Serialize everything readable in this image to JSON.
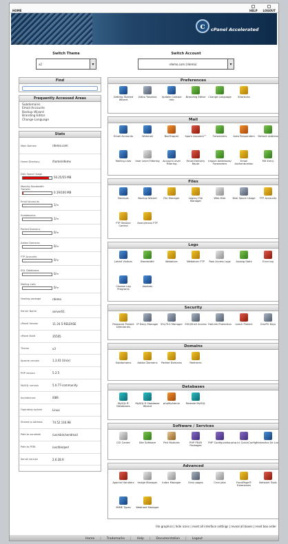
{
  "toolbar": {
    "home": "HOME",
    "help": "HELP",
    "logout": "LOGOUT"
  },
  "banner": {
    "logo_letter": "c",
    "brand": "cPanel Accelerated"
  },
  "crumb": "CPANEL 11",
  "switch_theme": {
    "label": "Switch Theme",
    "value": "x2"
  },
  "switch_account": {
    "label": "Switch Account",
    "value": "rdemo.com (rdemo)"
  },
  "find": {
    "title": "Find",
    "placeholder": ""
  },
  "faa": {
    "title": "Frequently Accessed Areas",
    "links": [
      "Subdomains",
      "Email Accounts",
      "Backup Wizard",
      "Branding Editor",
      "Change Language"
    ]
  },
  "stats": {
    "title": "Stats",
    "rows": [
      {
        "k": "Main Domain",
        "v": "rdemo.com"
      },
      {
        "k": "Home Directory",
        "v": "/home/rdemo"
      },
      {
        "k": "Disk Space Usage",
        "v": "50.25/55 MB",
        "bar": 0.91
      },
      {
        "k": "Monthly Bandwidth Transfer",
        "v": "0.19/100 MB",
        "bar": 0.002
      },
      {
        "k": "Email Accounts",
        "v": "1/∞",
        "bar": 0
      },
      {
        "k": "Subdomains",
        "v": "1/∞",
        "bar": 0
      },
      {
        "k": "Parked Domains",
        "v": "0/∞",
        "bar": 0
      },
      {
        "k": "Addon Domains",
        "v": "0/∞",
        "bar": 0
      },
      {
        "k": "FTP Accounts",
        "v": "0/∞",
        "bar": 0
      },
      {
        "k": "SQL Databases",
        "v": "0/∞",
        "bar": 0
      },
      {
        "k": "Mailing Lists",
        "v": "0/∞",
        "bar": 0
      },
      {
        "k": "Hosting package",
        "v": "rdemo"
      },
      {
        "k": "Server Name",
        "v": "server01"
      },
      {
        "k": "cPanel Version",
        "v": "11.24.5-RELEASE"
      },
      {
        "k": "cPanel Build",
        "v": "35505"
      },
      {
        "k": "Theme",
        "v": "x3"
      },
      {
        "k": "Apache version",
        "v": "1.3.41 (Unix)"
      },
      {
        "k": "PHP version",
        "v": "5.2.5"
      },
      {
        "k": "MySQL version",
        "v": "5.0.77-community"
      },
      {
        "k": "Architecture",
        "v": "i686"
      },
      {
        "k": "Operating system",
        "v": "Linux"
      },
      {
        "k": "Shared Ip Address",
        "v": "74.52.116.98"
      },
      {
        "k": "Path to sendmail",
        "v": "/usr/sbin/sendmail"
      },
      {
        "k": "Path to PERL",
        "v": "/usr/bin/perl"
      },
      {
        "k": "Kernel version",
        "v": "2.6.28.9"
      }
    ]
  },
  "sections": [
    {
      "id": "preferences",
      "title": "Preferences",
      "items": [
        {
          "label": "Getting Started Wizard",
          "icon": "wizard-icon",
          "c": "a"
        },
        {
          "label": "Video Tutorials",
          "icon": "video-icon",
          "c": "e"
        },
        {
          "label": "Update Contact Info",
          "icon": "contact-icon",
          "c": "a"
        },
        {
          "label": "Branding Editor",
          "icon": "branding-icon",
          "c": "c"
        },
        {
          "label": "Change Language",
          "icon": "language-icon",
          "c": "c"
        },
        {
          "label": "Shortcuts",
          "icon": "star-icon",
          "c": "b"
        }
      ]
    },
    {
      "id": "mail",
      "title": "Mail",
      "items": [
        {
          "label": "Email Accounts",
          "icon": "email-accounts-icon",
          "c": "a"
        },
        {
          "label": "Webmail",
          "icon": "webmail-icon",
          "c": "a"
        },
        {
          "label": "BoxTrapper",
          "icon": "boxtrapper-icon",
          "c": "f"
        },
        {
          "label": "Spam Assassin™",
          "icon": "spam-icon",
          "c": "d"
        },
        {
          "label": "Forwarders",
          "icon": "forwarders-icon",
          "c": "c"
        },
        {
          "label": "Auto Responders",
          "icon": "autoresponder-icon",
          "c": "f"
        },
        {
          "label": "Default Address",
          "icon": "default-address-icon",
          "c": "c"
        },
        {
          "label": "Mailing Lists",
          "icon": "mailing-list-icon",
          "c": "a"
        },
        {
          "label": "User Level Filtering",
          "icon": "user-filter-icon",
          "c": "i"
        },
        {
          "label": "Account Level Filtering",
          "icon": "account-filter-icon",
          "c": "a"
        },
        {
          "label": "Email Delivery Route",
          "icon": "delivery-route-icon",
          "c": "d"
        },
        {
          "label": "Import Addresses/ Forwarders",
          "icon": "import-icon",
          "c": "c"
        },
        {
          "label": "Email Authentication",
          "icon": "email-auth-icon",
          "c": "b"
        },
        {
          "label": "MX Entry",
          "icon": "mx-icon",
          "c": "c"
        }
      ]
    },
    {
      "id": "files",
      "title": "Files",
      "items": [
        {
          "label": "Backups",
          "icon": "backups-icon",
          "c": "a"
        },
        {
          "label": "Backup Wizard",
          "icon": "backup-wizard-icon",
          "c": "a"
        },
        {
          "label": "File Manager",
          "icon": "file-manager-icon",
          "c": "b"
        },
        {
          "label": "Legacy File Manager",
          "icon": "legacy-file-icon",
          "c": "b"
        },
        {
          "label": "Web Disk",
          "icon": "web-disk-icon",
          "c": "i"
        },
        {
          "label": "Disk Space Usage",
          "icon": "disk-usage-icon",
          "c": "e"
        },
        {
          "label": "FTP Accounts",
          "icon": "ftp-accounts-icon",
          "c": "b"
        },
        {
          "label": "FTP Session Control",
          "icon": "ftp-session-icon",
          "c": "b"
        },
        {
          "label": "Anonymous FTP",
          "icon": "anon-ftp-icon",
          "c": "b"
        }
      ]
    },
    {
      "id": "logs",
      "title": "Logs",
      "items": [
        {
          "label": "Latest Visitors",
          "icon": "visitors-icon",
          "c": "a"
        },
        {
          "label": "Bandwidth",
          "icon": "bandwidth-icon",
          "c": "c"
        },
        {
          "label": "Webalizer",
          "icon": "webalizer-icon",
          "c": "b"
        },
        {
          "label": "Webalizer FTP",
          "icon": "webalizer-ftp-icon",
          "c": "b"
        },
        {
          "label": "Raw Access Logs",
          "icon": "raw-logs-icon",
          "c": "i"
        },
        {
          "label": "Analog Stats",
          "icon": "analog-icon",
          "c": "c"
        },
        {
          "label": "Error log",
          "icon": "error-log-icon",
          "c": "d"
        },
        {
          "label": "Choose Log Programs",
          "icon": "log-programs-icon",
          "c": "a"
        },
        {
          "label": "Awstats",
          "icon": "awstats-icon",
          "c": "a"
        }
      ]
    },
    {
      "id": "security",
      "title": "Security",
      "items": [
        {
          "label": "Password Protect Directories",
          "icon": "password-protect-icon",
          "c": "b"
        },
        {
          "label": "IP Deny Manager",
          "icon": "ip-deny-icon",
          "c": "e"
        },
        {
          "label": "SSL/TLS Manager",
          "icon": "ssl-icon",
          "c": "e"
        },
        {
          "label": "SSH/Shell Access",
          "icon": "ssh-icon",
          "c": "e"
        },
        {
          "label": "HotLink Protection",
          "icon": "hotlink-icon",
          "c": "e"
        },
        {
          "label": "Leech Protect",
          "icon": "leech-icon",
          "c": "d"
        },
        {
          "label": "GnuPG Keys",
          "icon": "gnupg-icon",
          "c": "e"
        }
      ]
    },
    {
      "id": "domains",
      "title": "Domains",
      "items": [
        {
          "label": "Subdomains",
          "icon": "subdomains-icon",
          "c": "b"
        },
        {
          "label": "Addon Domains",
          "icon": "addon-domains-icon",
          "c": "b"
        },
        {
          "label": "Parked Domains",
          "icon": "parked-domains-icon",
          "c": "b"
        },
        {
          "label": "Redirects",
          "icon": "redirects-icon",
          "c": "b"
        }
      ]
    },
    {
      "id": "databases",
      "title": "Databases",
      "items": [
        {
          "label": "MySQL® Databases",
          "icon": "mysql-icon",
          "c": "h"
        },
        {
          "label": "MySQL® Database Wizard",
          "icon": "mysql-wizard-icon",
          "c": "h"
        },
        {
          "label": "phpMyAdmin",
          "icon": "phpmyadmin-icon",
          "c": "f"
        },
        {
          "label": "Remote MySQL",
          "icon": "remote-mysql-icon",
          "c": "h"
        }
      ]
    },
    {
      "id": "software",
      "title": "Software / Services",
      "items": [
        {
          "label": "CGI Center",
          "icon": "cgi-center-icon",
          "c": "i"
        },
        {
          "label": "Site Software",
          "icon": "site-software-icon",
          "c": "c"
        },
        {
          "label": "Perl Modules",
          "icon": "perl-icon",
          "c": "j"
        },
        {
          "label": "PHP PEAR Packages",
          "icon": "php-pear-icon",
          "c": "g"
        },
        {
          "label": "PHP Configuration",
          "icon": "php-config-icon",
          "c": "g"
        },
        {
          "label": "php.ini QuickConfig",
          "icon": "phpini-icon",
          "c": "g"
        },
        {
          "label": "Fantastico De Luxe",
          "icon": "fantastico-icon",
          "c": "a"
        }
      ]
    },
    {
      "id": "advanced",
      "title": "Advanced",
      "items": [
        {
          "label": "Apache Handlers",
          "icon": "apache-icon",
          "c": "d"
        },
        {
          "label": "Image Manager",
          "icon": "image-manager-icon",
          "c": "i"
        },
        {
          "label": "Index Manager",
          "icon": "index-manager-icon",
          "c": "i"
        },
        {
          "label": "Error pages",
          "icon": "error-pages-icon",
          "c": "e"
        },
        {
          "label": "Cron jobs",
          "icon": "cron-icon",
          "c": "i"
        },
        {
          "label": "FrontPage® Extensions",
          "icon": "frontpage-icon",
          "c": "b"
        },
        {
          "label": "Network Tools",
          "icon": "network-tools-icon",
          "c": "d"
        },
        {
          "label": "MIME Types",
          "icon": "mime-icon",
          "c": "a"
        },
        {
          "label": "Webhost Manager",
          "icon": "whm-icon",
          "c": "b"
        }
      ]
    }
  ],
  "footer_links": [
    "lite graphics",
    "hide icons",
    "reset all interface settings",
    "reveal all boxes",
    "reset box order"
  ],
  "bottom_nav": [
    "Home",
    "Trademarks",
    "Help",
    "Documentation",
    "Logout"
  ]
}
